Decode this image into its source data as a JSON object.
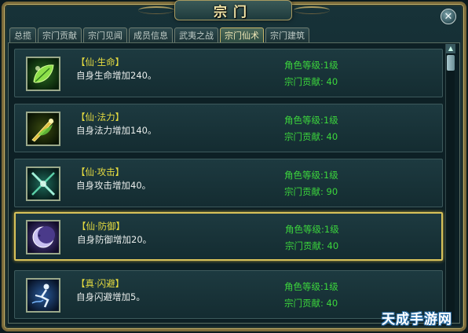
{
  "window": {
    "title": "宗门",
    "close_label": "✕"
  },
  "tabs": [
    {
      "label": "总揽",
      "active": false
    },
    {
      "label": "宗门贡献",
      "active": false
    },
    {
      "label": "宗门见闻",
      "active": false
    },
    {
      "label": "成员信息",
      "active": false
    },
    {
      "label": "武夷之战",
      "active": false
    },
    {
      "label": "宗门仙术",
      "active": true
    },
    {
      "label": "宗门建筑",
      "active": false
    }
  ],
  "skills": [
    {
      "name": "【仙·生命】",
      "desc": "自身生命增加240。",
      "level": "角色等级:1级",
      "contribution": "宗门贡献: 40",
      "icon": "leaf-icon",
      "selected": false
    },
    {
      "name": "【仙·法力】",
      "desc": "自身法力增加140。",
      "level": "角色等级:1级",
      "contribution": "宗门贡献: 40",
      "icon": "flame-sword-icon",
      "selected": false
    },
    {
      "name": "【仙·攻击】",
      "desc": "自身攻击增加40。",
      "level": "角色等级:1级",
      "contribution": "宗门贡献: 90",
      "icon": "crossed-swords-icon",
      "selected": false
    },
    {
      "name": "【仙·防御】",
      "desc": "自身防御增加20。",
      "level": "角色等级:1级",
      "contribution": "宗门贡献: 40",
      "icon": "moon-face-icon",
      "selected": true
    },
    {
      "name": "【真·闪避】",
      "desc": "自身闪避增加5。",
      "level": "角色等级:1级",
      "contribution": "宗门贡献: 40",
      "icon": "dodge-figure-icon",
      "selected": false
    }
  ],
  "watermark": "天成手游网",
  "colors": {
    "skill_name": "#e6dc40",
    "requirement_text": "#3cd63c",
    "selected_border": "#d8c25a"
  }
}
